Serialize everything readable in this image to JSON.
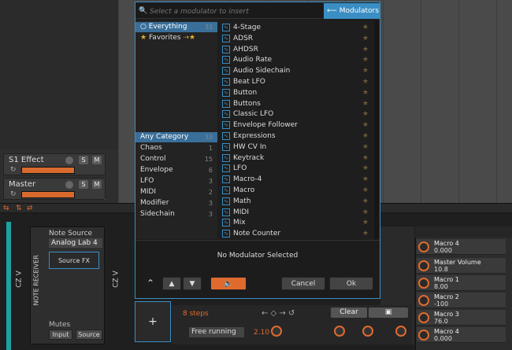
{
  "tracks": [
    {
      "name": "S1 Effect",
      "solo": "S",
      "mute": "M"
    },
    {
      "name": "Master",
      "solo": "S",
      "mute": "M"
    }
  ],
  "modal": {
    "search_placeholder": "Select a modulator to insert",
    "header": "Modulators",
    "top_categories": [
      {
        "label": "Everything",
        "count": "33"
      },
      {
        "label": "Favorites",
        "count": ""
      }
    ],
    "categories": [
      {
        "label": "Any Category",
        "count": "33"
      },
      {
        "label": "Chaos",
        "count": "1"
      },
      {
        "label": "Control",
        "count": "15"
      },
      {
        "label": "Envelope",
        "count": "6"
      },
      {
        "label": "LFO",
        "count": "3"
      },
      {
        "label": "MIDI",
        "count": "2"
      },
      {
        "label": "Modifier",
        "count": "3"
      },
      {
        "label": "Sidechain",
        "count": "3"
      }
    ],
    "modulators": [
      "4-Stage",
      "ADSR",
      "AHDSR",
      "Audio Rate",
      "Audio Sidechain",
      "Beat LFO",
      "Button",
      "Buttons",
      "Classic LFO",
      "Envelope Follower",
      "Expressions",
      "HW CV In",
      "Keytrack",
      "LFO",
      "Macro-4",
      "Macro",
      "Math",
      "MIDI",
      "Mix",
      "Note Counter"
    ],
    "no_selection": "No Modulator Selected",
    "cancel": "Cancel",
    "ok": "Ok"
  },
  "note_receiver": {
    "vertical_label": "NOTE RECEIVER",
    "note_source_title": "Note Source",
    "note_source_value": "Analog Lab 4",
    "source_fx": "Source FX",
    "mutes_title": "Mutes",
    "input": "Input",
    "source": "Source"
  },
  "chain_labels": [
    "CZ V",
    "CZ V"
  ],
  "sequencer": {
    "steps": "8 steps",
    "clear": "Clear",
    "mode": "Free running",
    "rate": "2.10"
  },
  "macros": [
    {
      "name": "Macro 4",
      "value": "0.000"
    },
    {
      "name": "Master Volume",
      "value": "10.8"
    },
    {
      "name": "Macro 1",
      "value": "8.00"
    },
    {
      "name": "Macro 2",
      "value": "-100"
    },
    {
      "name": "Macro 3",
      "value": "76.0"
    },
    {
      "name": "Macro 4",
      "value": "0.000"
    }
  ],
  "colors": {
    "accent": "#3a8ec4",
    "orange": "#e06a2e",
    "teal": "#1aa3a0"
  }
}
